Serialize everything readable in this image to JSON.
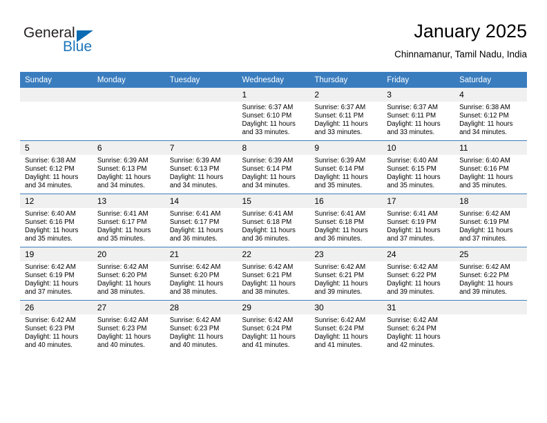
{
  "brand": {
    "name_part1": "General",
    "name_part2": "Blue",
    "triangle_icon": "triangle-icon",
    "accent_color": "#1b75bb"
  },
  "header": {
    "title": "January 2025",
    "subtitle": "Chinnamanur, Tamil Nadu, India"
  },
  "calendar": {
    "header_bg": "#3a7dbf",
    "daynum_bg": "#f0f0f0",
    "weekdays": [
      "Sunday",
      "Monday",
      "Tuesday",
      "Wednesday",
      "Thursday",
      "Friday",
      "Saturday"
    ],
    "weeks": [
      [
        {
          "day": "",
          "empty": true,
          "sunrise": "",
          "sunset": "",
          "daylight1": "",
          "daylight2": ""
        },
        {
          "day": "",
          "empty": true,
          "sunrise": "",
          "sunset": "",
          "daylight1": "",
          "daylight2": ""
        },
        {
          "day": "",
          "empty": true,
          "sunrise": "",
          "sunset": "",
          "daylight1": "",
          "daylight2": ""
        },
        {
          "day": "1",
          "empty": false,
          "sunrise": "Sunrise: 6:37 AM",
          "sunset": "Sunset: 6:10 PM",
          "daylight1": "Daylight: 11 hours",
          "daylight2": "and 33 minutes."
        },
        {
          "day": "2",
          "empty": false,
          "sunrise": "Sunrise: 6:37 AM",
          "sunset": "Sunset: 6:11 PM",
          "daylight1": "Daylight: 11 hours",
          "daylight2": "and 33 minutes."
        },
        {
          "day": "3",
          "empty": false,
          "sunrise": "Sunrise: 6:37 AM",
          "sunset": "Sunset: 6:11 PM",
          "daylight1": "Daylight: 11 hours",
          "daylight2": "and 33 minutes."
        },
        {
          "day": "4",
          "empty": false,
          "sunrise": "Sunrise: 6:38 AM",
          "sunset": "Sunset: 6:12 PM",
          "daylight1": "Daylight: 11 hours",
          "daylight2": "and 34 minutes."
        }
      ],
      [
        {
          "day": "5",
          "empty": false,
          "sunrise": "Sunrise: 6:38 AM",
          "sunset": "Sunset: 6:12 PM",
          "daylight1": "Daylight: 11 hours",
          "daylight2": "and 34 minutes."
        },
        {
          "day": "6",
          "empty": false,
          "sunrise": "Sunrise: 6:39 AM",
          "sunset": "Sunset: 6:13 PM",
          "daylight1": "Daylight: 11 hours",
          "daylight2": "and 34 minutes."
        },
        {
          "day": "7",
          "empty": false,
          "sunrise": "Sunrise: 6:39 AM",
          "sunset": "Sunset: 6:13 PM",
          "daylight1": "Daylight: 11 hours",
          "daylight2": "and 34 minutes."
        },
        {
          "day": "8",
          "empty": false,
          "sunrise": "Sunrise: 6:39 AM",
          "sunset": "Sunset: 6:14 PM",
          "daylight1": "Daylight: 11 hours",
          "daylight2": "and 34 minutes."
        },
        {
          "day": "9",
          "empty": false,
          "sunrise": "Sunrise: 6:39 AM",
          "sunset": "Sunset: 6:14 PM",
          "daylight1": "Daylight: 11 hours",
          "daylight2": "and 35 minutes."
        },
        {
          "day": "10",
          "empty": false,
          "sunrise": "Sunrise: 6:40 AM",
          "sunset": "Sunset: 6:15 PM",
          "daylight1": "Daylight: 11 hours",
          "daylight2": "and 35 minutes."
        },
        {
          "day": "11",
          "empty": false,
          "sunrise": "Sunrise: 6:40 AM",
          "sunset": "Sunset: 6:16 PM",
          "daylight1": "Daylight: 11 hours",
          "daylight2": "and 35 minutes."
        }
      ],
      [
        {
          "day": "12",
          "empty": false,
          "sunrise": "Sunrise: 6:40 AM",
          "sunset": "Sunset: 6:16 PM",
          "daylight1": "Daylight: 11 hours",
          "daylight2": "and 35 minutes."
        },
        {
          "day": "13",
          "empty": false,
          "sunrise": "Sunrise: 6:41 AM",
          "sunset": "Sunset: 6:17 PM",
          "daylight1": "Daylight: 11 hours",
          "daylight2": "and 35 minutes."
        },
        {
          "day": "14",
          "empty": false,
          "sunrise": "Sunrise: 6:41 AM",
          "sunset": "Sunset: 6:17 PM",
          "daylight1": "Daylight: 11 hours",
          "daylight2": "and 36 minutes."
        },
        {
          "day": "15",
          "empty": false,
          "sunrise": "Sunrise: 6:41 AM",
          "sunset": "Sunset: 6:18 PM",
          "daylight1": "Daylight: 11 hours",
          "daylight2": "and 36 minutes."
        },
        {
          "day": "16",
          "empty": false,
          "sunrise": "Sunrise: 6:41 AM",
          "sunset": "Sunset: 6:18 PM",
          "daylight1": "Daylight: 11 hours",
          "daylight2": "and 36 minutes."
        },
        {
          "day": "17",
          "empty": false,
          "sunrise": "Sunrise: 6:41 AM",
          "sunset": "Sunset: 6:19 PM",
          "daylight1": "Daylight: 11 hours",
          "daylight2": "and 37 minutes."
        },
        {
          "day": "18",
          "empty": false,
          "sunrise": "Sunrise: 6:42 AM",
          "sunset": "Sunset: 6:19 PM",
          "daylight1": "Daylight: 11 hours",
          "daylight2": "and 37 minutes."
        }
      ],
      [
        {
          "day": "19",
          "empty": false,
          "sunrise": "Sunrise: 6:42 AM",
          "sunset": "Sunset: 6:19 PM",
          "daylight1": "Daylight: 11 hours",
          "daylight2": "and 37 minutes."
        },
        {
          "day": "20",
          "empty": false,
          "sunrise": "Sunrise: 6:42 AM",
          "sunset": "Sunset: 6:20 PM",
          "daylight1": "Daylight: 11 hours",
          "daylight2": "and 38 minutes."
        },
        {
          "day": "21",
          "empty": false,
          "sunrise": "Sunrise: 6:42 AM",
          "sunset": "Sunset: 6:20 PM",
          "daylight1": "Daylight: 11 hours",
          "daylight2": "and 38 minutes."
        },
        {
          "day": "22",
          "empty": false,
          "sunrise": "Sunrise: 6:42 AM",
          "sunset": "Sunset: 6:21 PM",
          "daylight1": "Daylight: 11 hours",
          "daylight2": "and 38 minutes."
        },
        {
          "day": "23",
          "empty": false,
          "sunrise": "Sunrise: 6:42 AM",
          "sunset": "Sunset: 6:21 PM",
          "daylight1": "Daylight: 11 hours",
          "daylight2": "and 39 minutes."
        },
        {
          "day": "24",
          "empty": false,
          "sunrise": "Sunrise: 6:42 AM",
          "sunset": "Sunset: 6:22 PM",
          "daylight1": "Daylight: 11 hours",
          "daylight2": "and 39 minutes."
        },
        {
          "day": "25",
          "empty": false,
          "sunrise": "Sunrise: 6:42 AM",
          "sunset": "Sunset: 6:22 PM",
          "daylight1": "Daylight: 11 hours",
          "daylight2": "and 39 minutes."
        }
      ],
      [
        {
          "day": "26",
          "empty": false,
          "sunrise": "Sunrise: 6:42 AM",
          "sunset": "Sunset: 6:23 PM",
          "daylight1": "Daylight: 11 hours",
          "daylight2": "and 40 minutes."
        },
        {
          "day": "27",
          "empty": false,
          "sunrise": "Sunrise: 6:42 AM",
          "sunset": "Sunset: 6:23 PM",
          "daylight1": "Daylight: 11 hours",
          "daylight2": "and 40 minutes."
        },
        {
          "day": "28",
          "empty": false,
          "sunrise": "Sunrise: 6:42 AM",
          "sunset": "Sunset: 6:23 PM",
          "daylight1": "Daylight: 11 hours",
          "daylight2": "and 40 minutes."
        },
        {
          "day": "29",
          "empty": false,
          "sunrise": "Sunrise: 6:42 AM",
          "sunset": "Sunset: 6:24 PM",
          "daylight1": "Daylight: 11 hours",
          "daylight2": "and 41 minutes."
        },
        {
          "day": "30",
          "empty": false,
          "sunrise": "Sunrise: 6:42 AM",
          "sunset": "Sunset: 6:24 PM",
          "daylight1": "Daylight: 11 hours",
          "daylight2": "and 41 minutes."
        },
        {
          "day": "31",
          "empty": false,
          "sunrise": "Sunrise: 6:42 AM",
          "sunset": "Sunset: 6:24 PM",
          "daylight1": "Daylight: 11 hours",
          "daylight2": "and 42 minutes."
        },
        {
          "day": "",
          "empty": true,
          "sunrise": "",
          "sunset": "",
          "daylight1": "",
          "daylight2": ""
        }
      ]
    ]
  }
}
